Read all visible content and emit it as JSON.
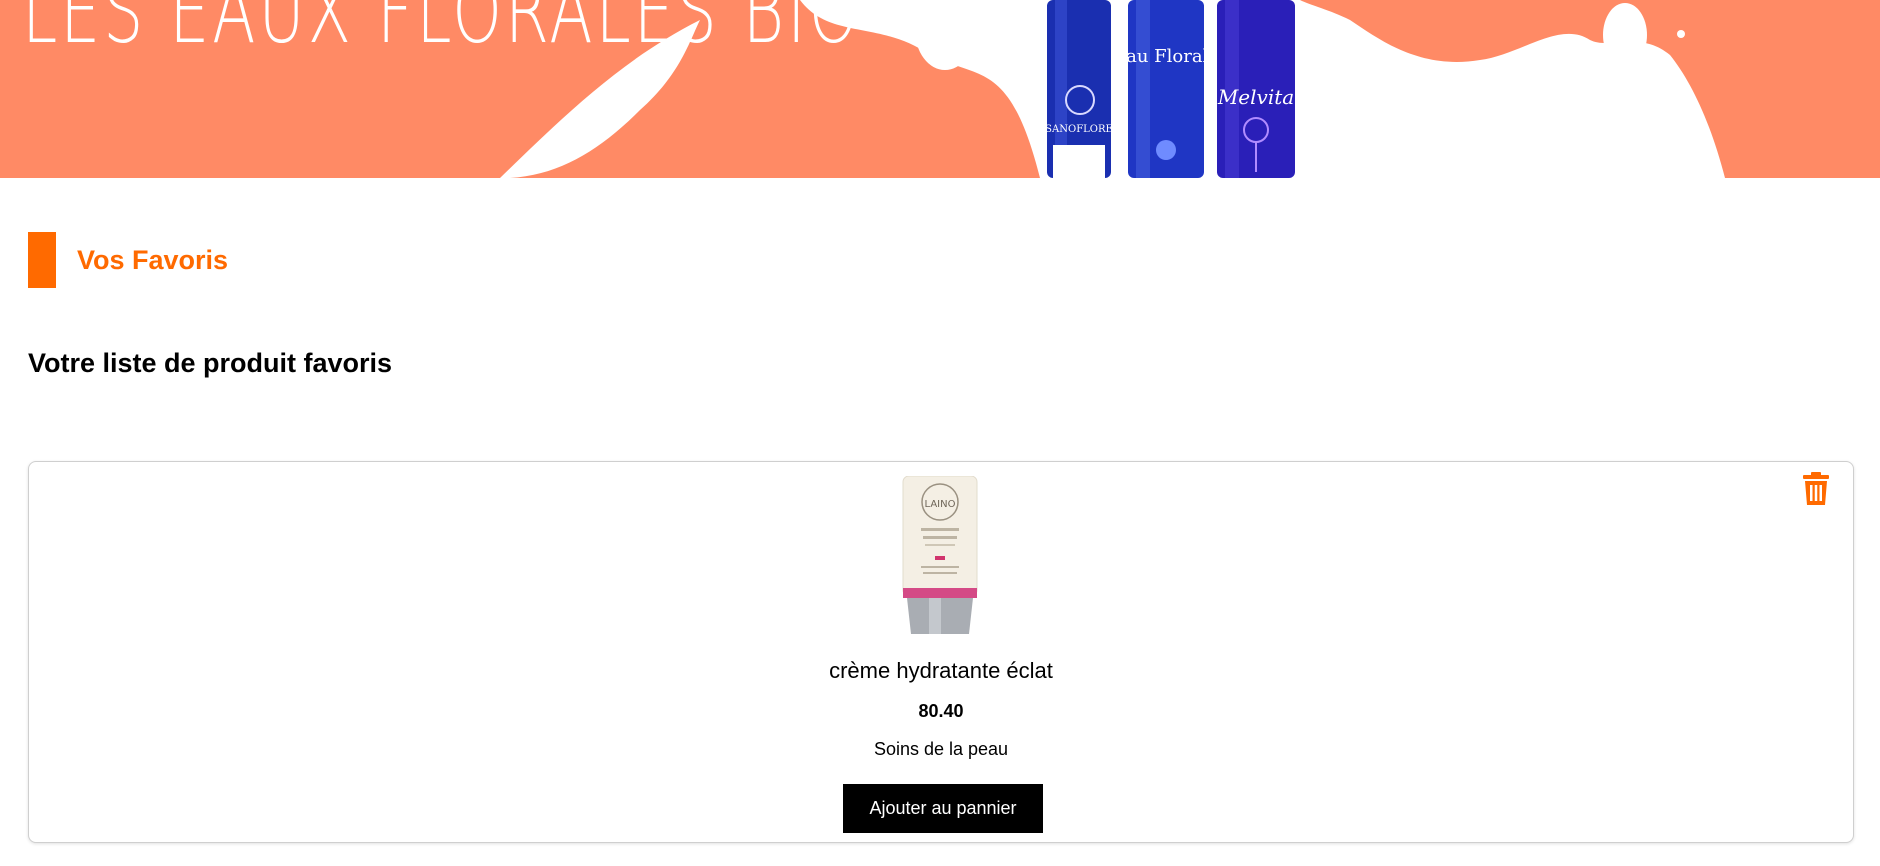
{
  "banner": {
    "title": "LES EAUX FLORALES BIO",
    "bottles": [
      "SANOFLORE",
      "Eau Florale",
      "Melvita"
    ]
  },
  "favorites": {
    "section_title": "Vos Favoris",
    "list_heading": "Votre liste de produit favoris"
  },
  "product": {
    "brand_on_tube": "LAINO",
    "name": "crème hydratante éclat",
    "price": "80.40",
    "category": "Soins de la peau",
    "add_button": "Ajouter au pannier",
    "delete_icon": "trash-icon"
  },
  "colors": {
    "accent": "#ff6a00",
    "banner": "#ff8a65",
    "button": "#000000"
  }
}
